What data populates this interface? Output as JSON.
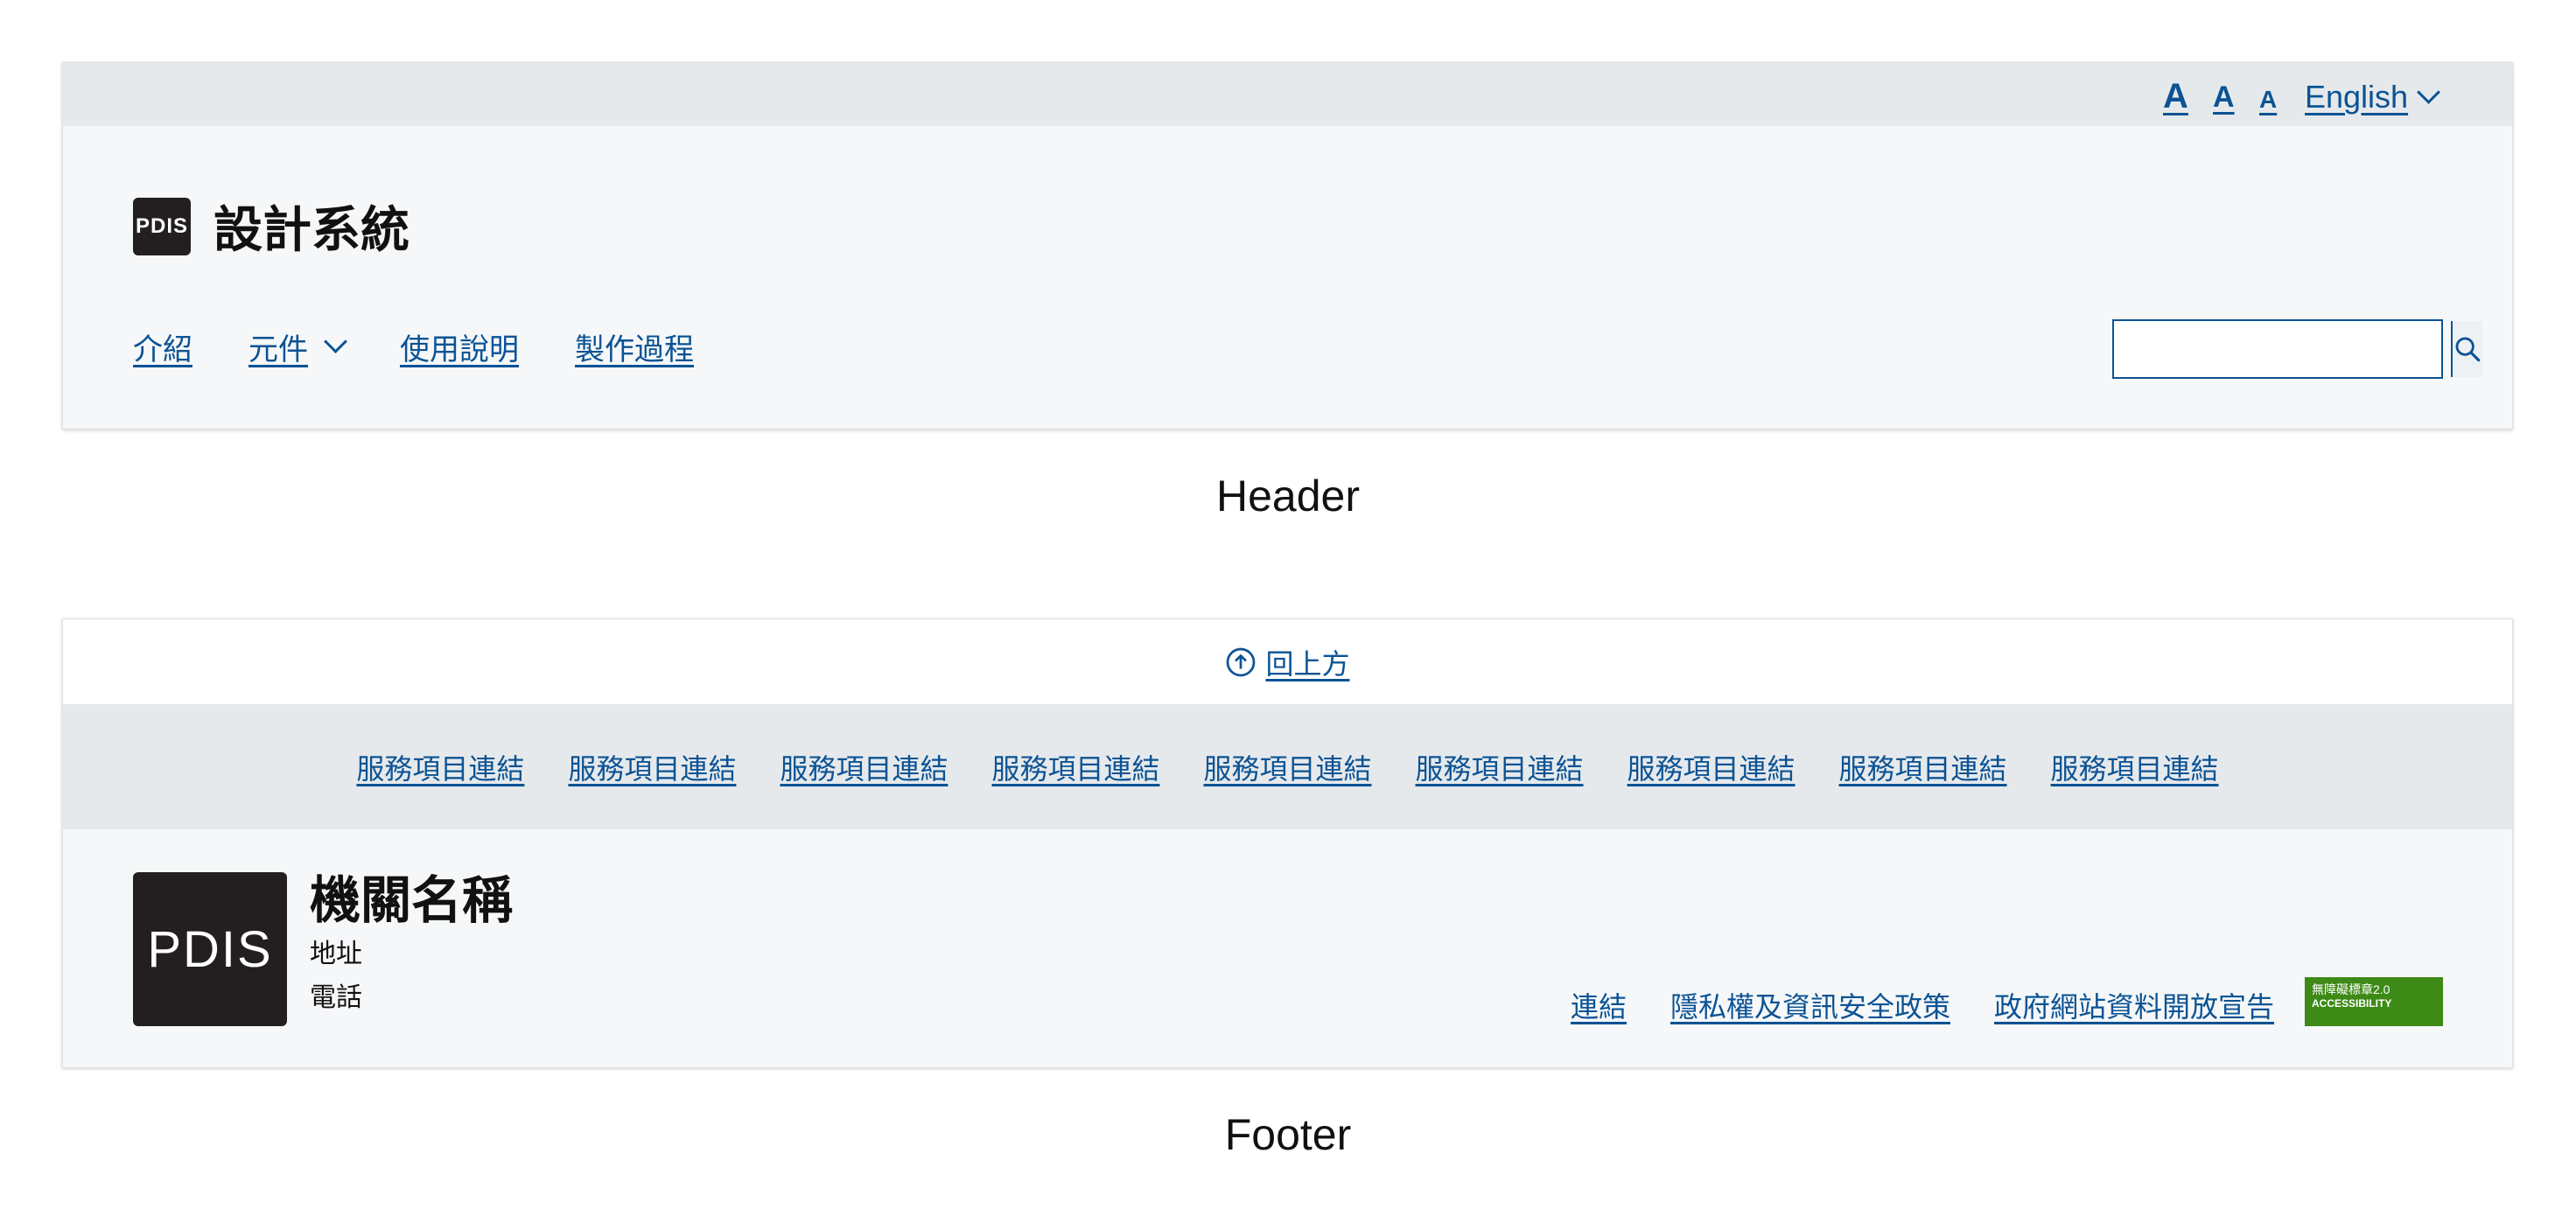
{
  "header": {
    "font_sizes": [
      "A",
      "A",
      "A"
    ],
    "language": "English",
    "logo_text": "PDIS",
    "site_title": "設計系統",
    "nav": [
      {
        "label": "介紹"
      },
      {
        "label": "元件"
      },
      {
        "label": "使用說明"
      },
      {
        "label": "製作過程"
      }
    ],
    "search_placeholder": ""
  },
  "header_caption": "Header",
  "footer": {
    "back_to_top": "回上方",
    "service_links": [
      "服務項目連結",
      "服務項目連結",
      "服務項目連結",
      "服務項目連結",
      "服務項目連結",
      "服務項目連結",
      "服務項目連結",
      "服務項目連結",
      "服務項目連結"
    ],
    "logo_text": "PDIS",
    "org_name": "機關名稱",
    "address": "地址",
    "phone": "電話",
    "links": [
      "連結",
      "隱私權及資訊安全政策",
      "政府網站資料開放宣告"
    ],
    "badge_line1": "無障礙標章2.0",
    "badge_line2": "ACCESSIBILITY"
  },
  "footer_caption": "Footer",
  "colors": {
    "link": "#0b5394",
    "topbar": "#e6e9ec",
    "panel": "#f5f7f9",
    "badge": "#3d8a17"
  }
}
